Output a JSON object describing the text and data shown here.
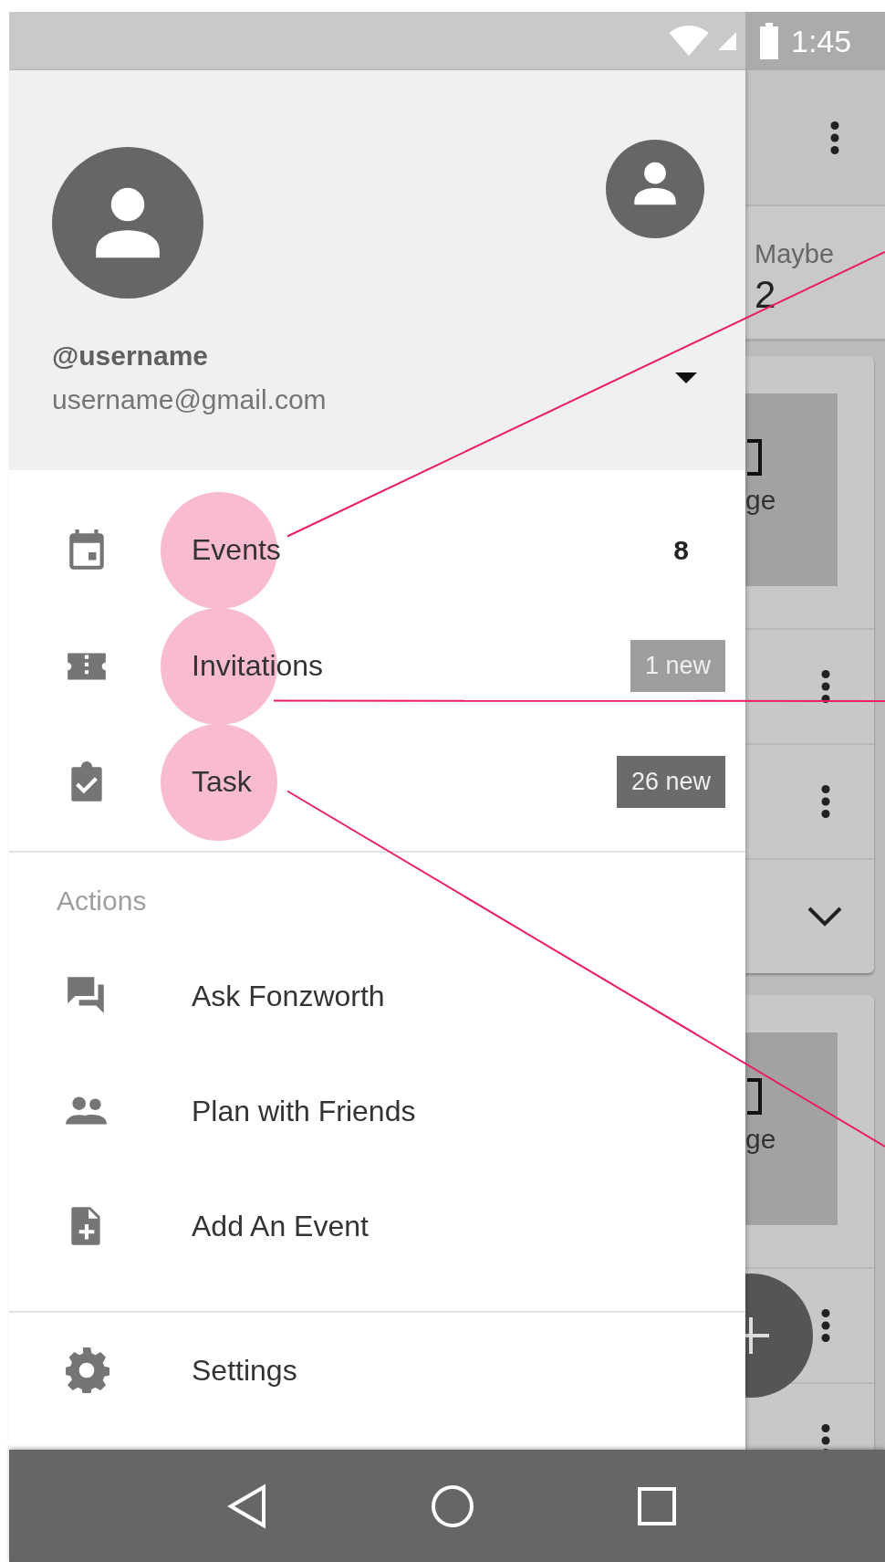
{
  "status_bar": {
    "time": "1:45"
  },
  "background_app": {
    "tab": {
      "label": "Maybe",
      "count": "2"
    },
    "cards": [
      {
        "image_text": "ge",
        "rows": [
          {
            "kind": "more"
          },
          {
            "kind": "more"
          },
          {
            "kind": "expand"
          }
        ]
      },
      {
        "image_text": "ge",
        "rows": [
          {
            "kind": "more"
          },
          {
            "kind": "more"
          }
        ]
      }
    ]
  },
  "drawer": {
    "account": {
      "username": "@username",
      "email": "username@gmail.com"
    },
    "nav_items": [
      {
        "label": "Events",
        "kind": "count",
        "count": "8",
        "annotated": true
      },
      {
        "label": "Invitations",
        "kind": "badge",
        "badge": "1 new",
        "color": "#9e9e9e",
        "annotated": true
      },
      {
        "label": "Task",
        "kind": "badge",
        "badge": "26 new",
        "color": "#6b6b6b",
        "annotated": true
      }
    ],
    "section_label": "Actions",
    "actions": [
      {
        "label": "Ask Fonzworth"
      },
      {
        "label": "Plan with Friends"
      },
      {
        "label": "Add An Event"
      }
    ],
    "footer_items": [
      {
        "label": "Settings"
      }
    ]
  }
}
